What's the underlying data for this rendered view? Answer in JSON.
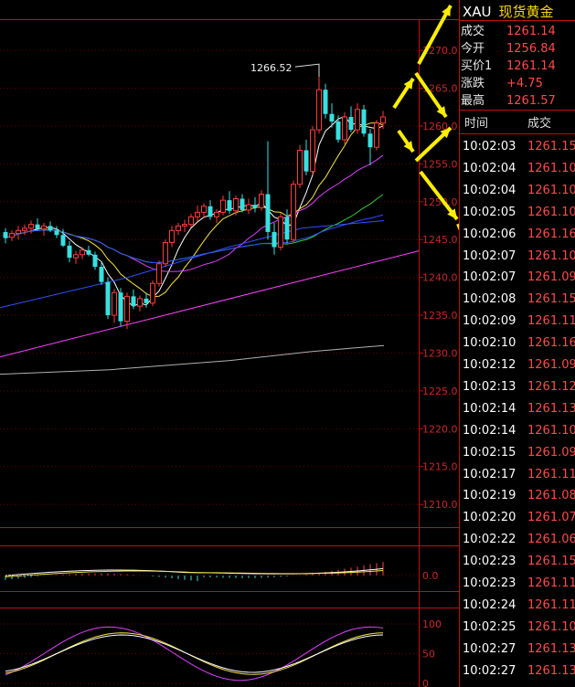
{
  "header": {
    "symbol": "XAU",
    "name": "现货黄金"
  },
  "quote": [
    {
      "label": "成交",
      "value": "1261.14"
    },
    {
      "label": "今开",
      "value": "1256.84"
    },
    {
      "label": "买价1",
      "value": "1261.14"
    },
    {
      "label": "涨跌",
      "value": "+4.75"
    },
    {
      "label": "最高",
      "value": "1261.57"
    }
  ],
  "trade_list": {
    "headers": {
      "time": "时间",
      "price": "成交"
    },
    "rows": [
      {
        "time": "10:02:03",
        "price": "1261.15"
      },
      {
        "time": "10:02:04",
        "price": "1261.10"
      },
      {
        "time": "10:02:04",
        "price": "1261.10"
      },
      {
        "time": "10:02:05",
        "price": "1261.10"
      },
      {
        "time": "10:02:06",
        "price": "1261.16"
      },
      {
        "time": "10:02:07",
        "price": "1261.10"
      },
      {
        "time": "10:02:07",
        "price": "1261.09"
      },
      {
        "time": "10:02:08",
        "price": "1261.15"
      },
      {
        "time": "10:02:09",
        "price": "1261.11"
      },
      {
        "time": "10:02:10",
        "price": "1261.16"
      },
      {
        "time": "10:02:12",
        "price": "1261.09"
      },
      {
        "time": "10:02:13",
        "price": "1261.12"
      },
      {
        "time": "10:02:14",
        "price": "1261.13"
      },
      {
        "time": "10:02:14",
        "price": "1261.10"
      },
      {
        "time": "10:02:15",
        "price": "1261.09"
      },
      {
        "time": "10:02:17",
        "price": "1261.11"
      },
      {
        "time": "10:02:19",
        "price": "1261.08"
      },
      {
        "time": "10:02:20",
        "price": "1261.07"
      },
      {
        "time": "10:02:22",
        "price": "1261.06"
      },
      {
        "time": "10:02:23",
        "price": "1261.15"
      },
      {
        "time": "10:02:23",
        "price": "1261.11"
      },
      {
        "time": "10:02:24",
        "price": "1261.11"
      },
      {
        "time": "10:02:25",
        "price": "1261.10"
      },
      {
        "time": "10:02:27",
        "price": "1261.13"
      },
      {
        "time": "10:02:27",
        "price": "1261.13"
      }
    ]
  },
  "chart_data": [
    {
      "type": "candlestick",
      "title": "",
      "ylim": [
        1207,
        1274
      ],
      "yticks": [
        "1270.0",
        "1265.0",
        "1260.0",
        "1255.0",
        "1250.0",
        "1245.0",
        "1240.0",
        "1235.0",
        "1230.0",
        "1225.0",
        "1220.0",
        "1215.0",
        "1210.0"
      ],
      "annotation": "1266.52",
      "candles": [
        [
          1246.0,
          1246.5,
          1244.5,
          1245.2
        ],
        [
          1245.3,
          1246.2,
          1244.8,
          1245.8
        ],
        [
          1245.8,
          1246.8,
          1245.0,
          1246.2
        ],
        [
          1246.2,
          1247.0,
          1245.6,
          1246.5
        ],
        [
          1246.5,
          1247.5,
          1245.8,
          1247.0
        ],
        [
          1247.0,
          1247.8,
          1246.2,
          1246.4
        ],
        [
          1246.4,
          1247.2,
          1245.5,
          1246.8
        ],
        [
          1246.8,
          1247.4,
          1246.0,
          1246.2
        ],
        [
          1246.2,
          1246.8,
          1245.2,
          1245.6
        ],
        [
          1245.6,
          1246.4,
          1244.0,
          1244.2
        ],
        [
          1244.2,
          1244.8,
          1242.0,
          1242.6
        ],
        [
          1242.6,
          1243.5,
          1241.8,
          1243.0
        ],
        [
          1243.0,
          1244.0,
          1242.4,
          1243.6
        ],
        [
          1243.6,
          1244.2,
          1242.8,
          1243.0
        ],
        [
          1243.0,
          1243.4,
          1241.0,
          1241.4
        ],
        [
          1241.4,
          1242.0,
          1239.0,
          1239.4
        ],
        [
          1239.4,
          1240.0,
          1234.5,
          1235.0
        ],
        [
          1235.0,
          1238.5,
          1234.0,
          1238.0
        ],
        [
          1238.0,
          1238.6,
          1233.5,
          1234.2
        ],
        [
          1234.2,
          1238.0,
          1233.2,
          1237.5
        ],
        [
          1237.5,
          1238.4,
          1235.8,
          1236.2
        ],
        [
          1236.2,
          1237.6,
          1235.5,
          1237.2
        ],
        [
          1237.2,
          1238.0,
          1236.0,
          1236.6
        ],
        [
          1236.6,
          1239.6,
          1236.2,
          1239.2
        ],
        [
          1239.2,
          1242.2,
          1238.8,
          1241.8
        ],
        [
          1241.8,
          1245.0,
          1241.4,
          1244.6
        ],
        [
          1244.6,
          1246.8,
          1244.0,
          1246.2
        ],
        [
          1246.2,
          1247.2,
          1245.6,
          1246.8
        ],
        [
          1246.8,
          1247.6,
          1246.0,
          1247.0
        ],
        [
          1247.0,
          1248.4,
          1246.6,
          1248.0
        ],
        [
          1248.0,
          1249.5,
          1247.4,
          1248.6
        ],
        [
          1248.6,
          1249.8,
          1247.8,
          1249.4
        ],
        [
          1249.4,
          1250.2,
          1247.6,
          1248.0
        ],
        [
          1248.0,
          1249.0,
          1247.2,
          1248.6
        ],
        [
          1248.6,
          1250.8,
          1248.2,
          1250.2
        ],
        [
          1250.2,
          1251.4,
          1248.4,
          1248.8
        ],
        [
          1248.8,
          1250.8,
          1248.2,
          1250.4
        ],
        [
          1250.4,
          1251.0,
          1248.6,
          1248.9
        ],
        [
          1248.9,
          1250.4,
          1248.4,
          1249.6
        ],
        [
          1249.6,
          1250.6,
          1248.6,
          1249.2
        ],
        [
          1249.2,
          1251.5,
          1248.8,
          1251.0
        ],
        [
          1251.0,
          1258.0,
          1245.0,
          1246.0
        ],
        [
          1246.0,
          1247.2,
          1243.0,
          1244.0
        ],
        [
          1244.0,
          1248.5,
          1243.6,
          1248.0
        ],
        [
          1248.0,
          1249.0,
          1244.5,
          1245.0
        ],
        [
          1245.0,
          1252.8,
          1244.6,
          1252.3
        ],
        [
          1252.3,
          1257.5,
          1251.8,
          1256.8
        ],
        [
          1256.8,
          1258.2,
          1253.5,
          1254.0
        ],
        [
          1254.0,
          1260.0,
          1253.6,
          1259.5
        ],
        [
          1259.5,
          1266.5,
          1259.0,
          1264.8
        ],
        [
          1264.8,
          1265.6,
          1261.0,
          1261.6
        ],
        [
          1261.6,
          1263.0,
          1259.8,
          1260.6
        ],
        [
          1260.6,
          1261.4,
          1257.8,
          1258.2
        ],
        [
          1258.2,
          1261.8,
          1257.6,
          1261.2
        ],
        [
          1261.2,
          1262.6,
          1259.2,
          1259.5
        ],
        [
          1259.5,
          1263.0,
          1259.0,
          1262.2
        ],
        [
          1262.2,
          1262.8,
          1258.6,
          1259.0
        ],
        [
          1259.0,
          1259.6,
          1254.8,
          1257.2
        ],
        [
          1257.2,
          1260.8,
          1256.8,
          1260.4
        ],
        [
          1260.4,
          1262.0,
          1259.6,
          1261.2
        ]
      ]
    },
    {
      "type": "macd",
      "ytick": "0.0"
    },
    {
      "type": "oscillator",
      "yticks": [
        "100",
        "50",
        "0"
      ]
    }
  ]
}
